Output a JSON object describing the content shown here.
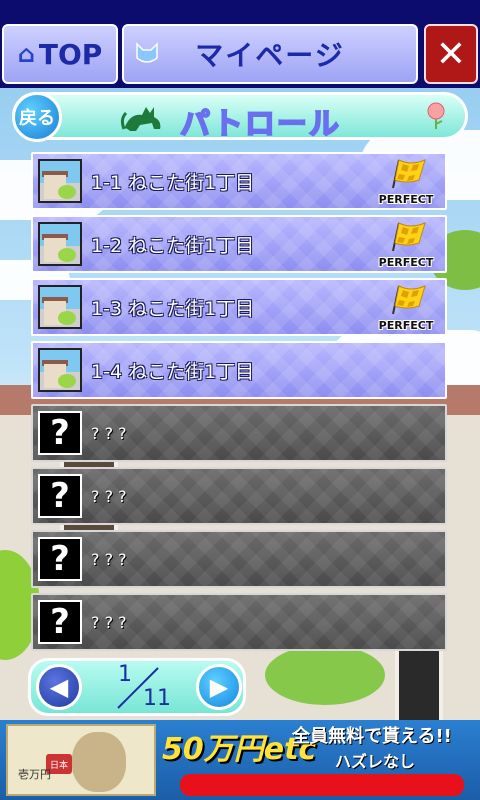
{
  "header": {
    "top_label": "TOP",
    "title": "マイページ",
    "close_label": "✕"
  },
  "section": {
    "back_label": "戻る",
    "title": "パトロール"
  },
  "stages": [
    {
      "label": "1-1 ねこた街1丁目",
      "locked": false,
      "perfect": true
    },
    {
      "label": "1-2 ねこた街1丁目",
      "locked": false,
      "perfect": true
    },
    {
      "label": "1-3 ねこた街1丁目",
      "locked": false,
      "perfect": true
    },
    {
      "label": "1-4 ねこた街1丁目",
      "locked": false,
      "perfect": false
    },
    {
      "label": "? ? ?",
      "locked": true,
      "perfect": false
    },
    {
      "label": "? ? ?",
      "locked": true,
      "perfect": false
    },
    {
      "label": "? ? ?",
      "locked": true,
      "perfect": false
    },
    {
      "label": "? ? ?",
      "locked": true,
      "perfect": false
    }
  ],
  "perfect_badge": "PERFECT",
  "locked_mark": "?",
  "pager": {
    "current": "1",
    "total": "11"
  },
  "ad": {
    "amount": "50万円etc",
    "free_text": "全員無料で貰える!!",
    "no_miss": "ハズレなし",
    "bill_text": "壱万円",
    "seal": "日本"
  }
}
